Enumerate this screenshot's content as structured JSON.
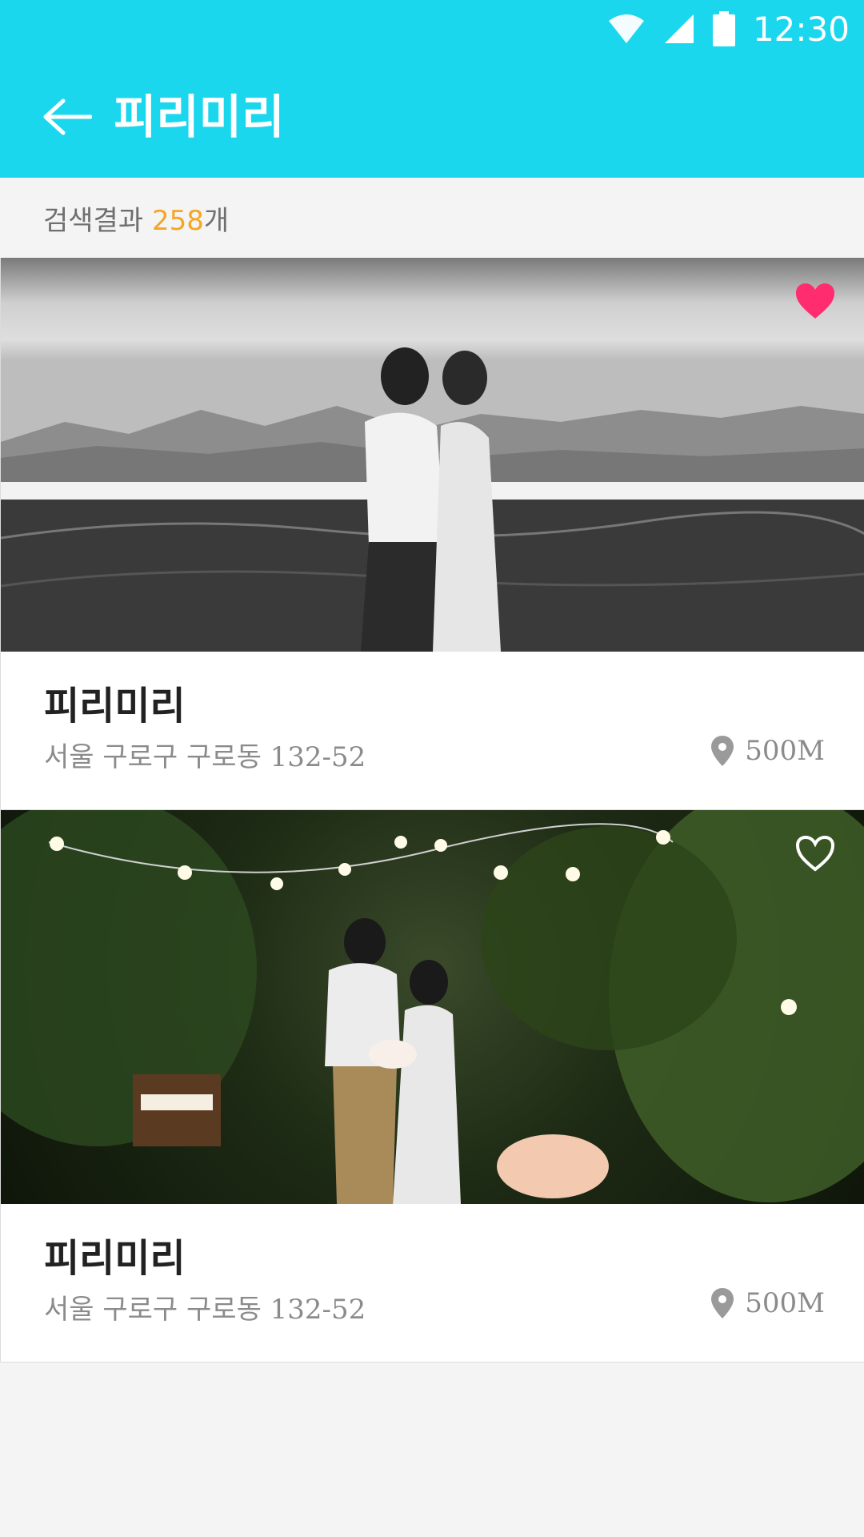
{
  "status_bar": {
    "time": "12:30",
    "icons": [
      "wifi-icon",
      "signal-icon",
      "battery-icon"
    ]
  },
  "toolbar": {
    "title": "피리미리",
    "back_icon": "arrow-left-icon"
  },
  "results": {
    "prefix": "검색결과 ",
    "count": "258",
    "suffix": "개"
  },
  "listings": [
    {
      "title": "피리미리",
      "address": "서울 구로구 구로동 132-52",
      "distance": "500M",
      "favorited": true,
      "photo": "black-and-white couple kissing on tidal flat with mountains"
    },
    {
      "title": "피리미리",
      "address": "서울 구로구 구로동 132-52",
      "distance": "500M",
      "favorited": false,
      "photo": "couple in night garden with string lights"
    }
  ],
  "colors": {
    "appbar": "#1bd7ee",
    "accent_count": "#f5a623",
    "heart_active": "#ff2d6f",
    "text_primary": "#222222",
    "text_secondary": "#8b8b8b"
  }
}
